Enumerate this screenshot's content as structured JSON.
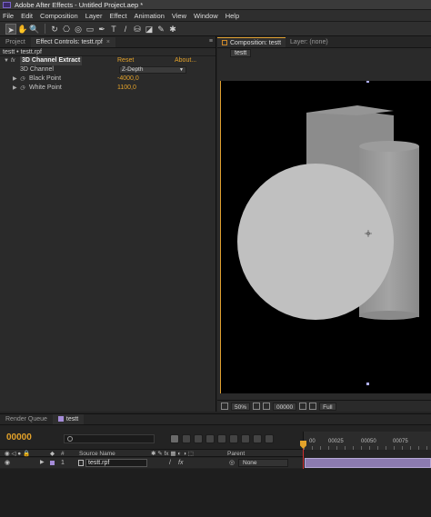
{
  "window": {
    "title": "Adobe After Effects - Untitled Project.aep *"
  },
  "menu": [
    "File",
    "Edit",
    "Composition",
    "Layer",
    "Effect",
    "Animation",
    "View",
    "Window",
    "Help"
  ],
  "toolbar": {
    "tools": [
      "selection-tool",
      "hand-tool",
      "zoom-tool",
      "rotation-tool",
      "camera-tool",
      "pan-behind-tool",
      "mask-tool",
      "pen-tool",
      "type-tool",
      "brush-tool",
      "clone-stamp-tool",
      "eraser-tool",
      "roto-brush-tool",
      "puppet-tool"
    ],
    "glyphs": [
      "➤",
      "✋",
      "🔍",
      "↻",
      "⎔",
      "◎",
      "▭",
      "✒",
      "T",
      "/",
      "⛁",
      "◪",
      "✎",
      "✱"
    ]
  },
  "effect_controls": {
    "tab_project": "Project",
    "tab_effect": "Effect Controls: testt.rpf",
    "header": "testt • testt.rpf",
    "effect": {
      "name": "3D Channel Extract",
      "reset": "Reset",
      "about": "About...",
      "fx": "fx",
      "params": [
        {
          "label": "3D Channel",
          "value": "Z-Depth",
          "kind": "dropdown"
        },
        {
          "label": "Black Point",
          "value": "-4000,0",
          "kind": "number"
        },
        {
          "label": "White Point",
          "value": "1100,0",
          "kind": "number"
        }
      ]
    }
  },
  "composition": {
    "tab_label": "Composition: testt",
    "tab_layer": "Layer: (none)",
    "crumb": "testt",
    "footer": {
      "magnification": "50%",
      "timecode": "00000",
      "resolution": "Full"
    }
  },
  "timeline": {
    "tab_render": "Render Queue",
    "tab_comp": "testt",
    "timecode": "00000",
    "columns": {
      "source_name": "Source Name",
      "parent": "Parent",
      "number": "#"
    },
    "layers": [
      {
        "index": "1",
        "name": "testt.rpf",
        "parent": "None"
      }
    ],
    "ruler_ticks": [
      "00",
      "00025",
      "00050",
      "00075"
    ]
  },
  "colors": {
    "accent": "#e3a22a",
    "track": "#8c7bb0",
    "cti": "#d03030"
  }
}
